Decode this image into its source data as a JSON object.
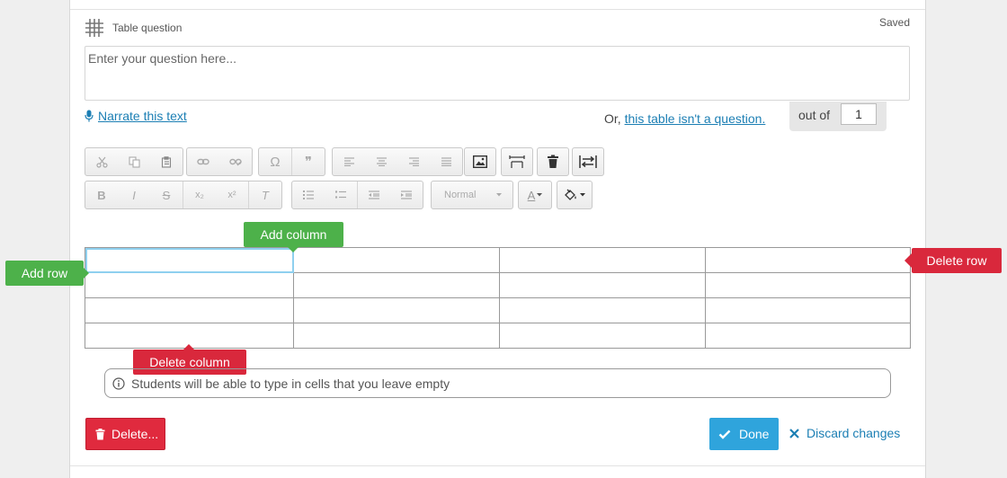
{
  "header": {
    "type_label": "Table question",
    "status": "Saved"
  },
  "question": {
    "placeholder": "Enter your question here..."
  },
  "narrate": {
    "label": "Narrate this text"
  },
  "not_question": {
    "prefix": "Or, ",
    "link": "this table isn't a question."
  },
  "score": {
    "label": "out of",
    "value": "1"
  },
  "toolbar": {
    "row1": [
      {
        "group": "clipboard",
        "icons": [
          "cut-icon",
          "copy-icon",
          "paste-icon"
        ]
      },
      {
        "group": "links",
        "icons": [
          "link-icon",
          "unlink-icon"
        ]
      },
      {
        "group": "insert",
        "icons": [
          "special-character-icon",
          "blockquote-icon"
        ]
      },
      {
        "group": "align",
        "icons": [
          "align-left-icon",
          "align-center-icon",
          "align-right-icon",
          "align-justify-icon"
        ]
      },
      {
        "group": "image",
        "icons": [
          "image-icon"
        ]
      },
      {
        "group": "table-width",
        "icons": [
          "table-width-icon"
        ]
      },
      {
        "group": "delete-table",
        "icons": [
          "trash-icon"
        ]
      },
      {
        "group": "swap",
        "icons": [
          "swap-arrows-icon"
        ]
      }
    ],
    "omega_symbol": "Ω",
    "quote_symbol": "❞",
    "bold": "B",
    "italic": "I",
    "strike": "S",
    "subscript": "x₂",
    "superscript": "x²",
    "clear_format": "T",
    "format_select": "Normal",
    "font_color": "A"
  },
  "table": {
    "rows": 4,
    "columns": 4,
    "cells": [
      [
        "",
        "",
        "",
        ""
      ],
      [
        "",
        "",
        "",
        ""
      ],
      [
        "",
        "",
        "",
        ""
      ],
      [
        "",
        "",
        "",
        ""
      ]
    ]
  },
  "table_actions": {
    "add_column": "Add column",
    "add_row": "Add row",
    "delete_row": "Delete row",
    "delete_column": "Delete column"
  },
  "info": {
    "text": "Students will be able to type in cells that you leave empty"
  },
  "actions": {
    "delete": "Delete...",
    "done": "Done",
    "discard": "Discard changes"
  },
  "colors": {
    "green": "#4db14a",
    "red": "#d9283c",
    "blue": "#2fa4dc",
    "link": "#1c7fb4"
  }
}
